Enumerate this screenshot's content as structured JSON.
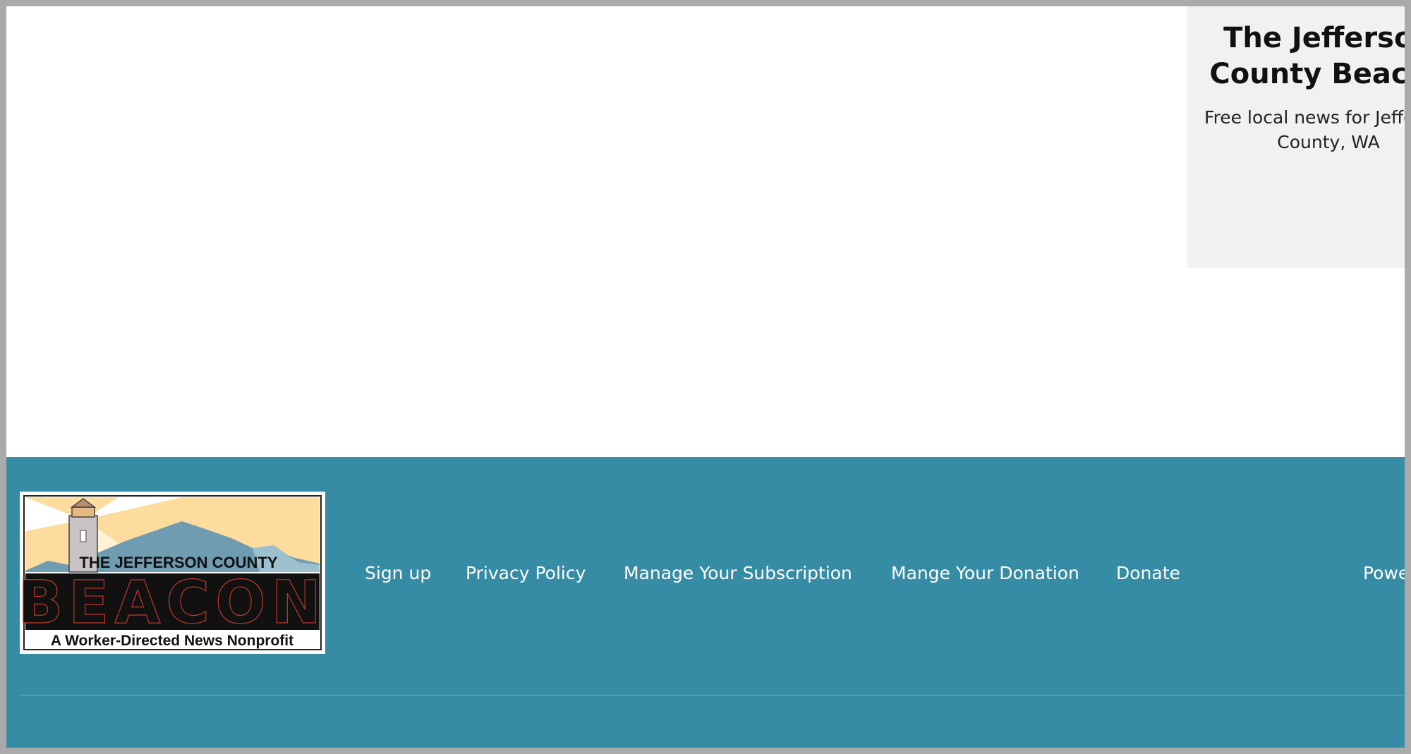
{
  "sidebar_card": {
    "title": "The Jefferson\nCounty Beacon",
    "subtitle": "Free local news for Jefferson\nCounty, WA"
  },
  "footer": {
    "logo": {
      "top_text": "THE JEFFERSON COUNTY",
      "main_text": "BEACON",
      "tagline": "A Worker-Directed News Nonprofit"
    },
    "nav_links": [
      "Sign up",
      "Privacy Policy",
      "Manage Your Subscription",
      "Mange Your Donation",
      "Donate"
    ],
    "powered_text": "Powe"
  },
  "colors": {
    "footer_bg": "#358ca4",
    "card_bg": "#f1f1f1",
    "logo_sky": "#fddc9e",
    "logo_mountain": "#6f9cb0"
  }
}
